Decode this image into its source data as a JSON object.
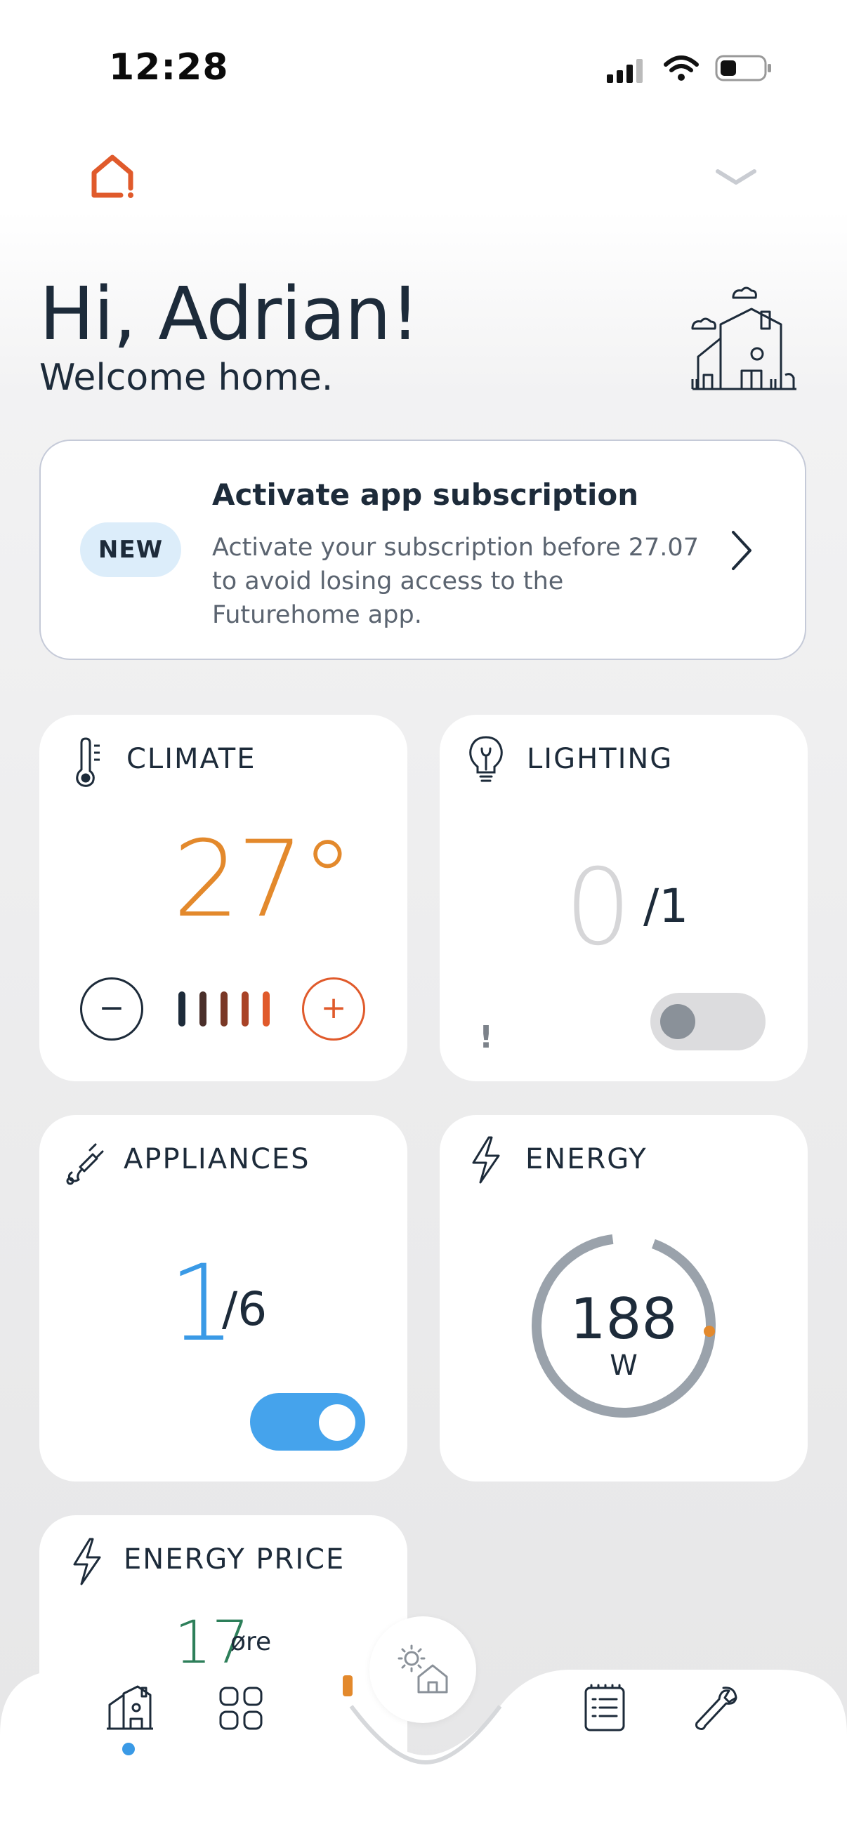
{
  "status_bar": {
    "time": "12:28"
  },
  "header": {
    "greeting": "Hi, Adrian!",
    "subtitle": "Welcome home."
  },
  "banner": {
    "badge": "NEW",
    "title": "Activate app subscription",
    "text": "Activate your subscription before 27.07 to avoid losing access to the Futurehome app."
  },
  "climate": {
    "title": "CLIMATE",
    "temperature": "27°",
    "minus": "−",
    "plus": "+"
  },
  "lighting": {
    "title": "LIGHTING",
    "on": "0",
    "total": "/1",
    "warning": "!",
    "toggle_on": false
  },
  "appliances": {
    "title": "APPLIANCES",
    "on": "1",
    "total": "/6",
    "toggle_on": true
  },
  "energy": {
    "title": "ENERGY",
    "value": "188",
    "unit": "W"
  },
  "energy_price": {
    "title": "ENERGY PRICE",
    "value": "17",
    "unit": "øre"
  },
  "bottom_nav": {
    "items": [
      "home-icon",
      "grid-icon",
      "modes-icon",
      "log-icon",
      "wrench-icon"
    ],
    "active": "home-icon"
  },
  "colors": {
    "accent_orange": "#e3892c",
    "accent_blue": "#3a9ae6",
    "brand_red": "#e05a2b"
  }
}
